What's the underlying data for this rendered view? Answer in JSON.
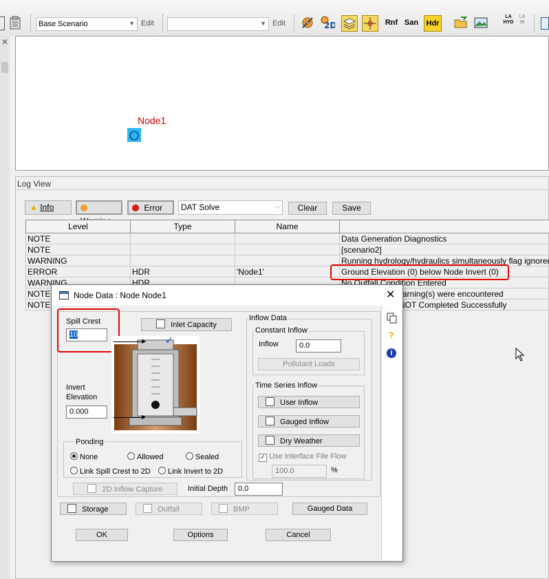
{
  "toolbar": {
    "scenario": "Base Scenario",
    "edit1": "Edit",
    "combo2": "",
    "edit2": "Edit",
    "icons": [
      "gear-run-icon",
      "2d-icon",
      "layers-icon",
      "crosshair-icon"
    ],
    "rnf": "Rnf",
    "san": "San",
    "hdr": "Hdr",
    "la_hyd_top": "LA",
    "la_hyd_bottom": "HYD",
    "la_ib_top": "LA",
    "la_ib_bottom": "IB"
  },
  "canvas": {
    "node_label": "Node1"
  },
  "log": {
    "title": "Log View",
    "filters": {
      "info": "Info",
      "warning": "Warning",
      "error": "Error"
    },
    "source": "DAT Solve",
    "clear": "Clear",
    "save": "Save",
    "columns": [
      "Level",
      "Type",
      "Name",
      ""
    ],
    "rows": [
      [
        "NOTE",
        "",
        "",
        "Data Generation Diagnostics"
      ],
      [
        "NOTE",
        "",
        "",
        "[scenario2]"
      ],
      [
        "WARNING",
        "",
        "",
        "Running hydrology/hydraulics simultaneously flag ignored"
      ],
      [
        "ERROR",
        "HDR",
        "'Node1'",
        "Ground Elevation (0) below Node Invert (0)"
      ],
      [
        "WARNING",
        "HDR",
        "",
        "No Outfall Condition Entered"
      ],
      [
        "NOTE",
        "",
        "",
        "Warning(s) were encountered"
      ],
      [
        "NOTE",
        "",
        "",
        "NOT Completed Successfully"
      ]
    ]
  },
  "dialog": {
    "title": "Node Data : Node Node1",
    "spill_crest_label": "Spill Crest",
    "spill_crest_value": "10",
    "inlet_capacity": "Inlet Capacity",
    "invert_label_1": "Invert",
    "invert_label_2": "Elevation",
    "invert_value": "0.000",
    "ponding": {
      "label": "Ponding",
      "none": "None",
      "allowed": "Allowed",
      "sealed": "Sealed",
      "link_spill": "Link Spill Crest to 2D",
      "link_invert": "Link Invert to 2D"
    },
    "inflow_capture": "2D Inflow Capture",
    "initial_depth_label": "Initial Depth",
    "initial_depth_value": "0.0",
    "inflow_data": "Inflow Data",
    "constant_inflow": "Constant Inflow",
    "inflow_label": "Inflow",
    "inflow_value": "0.0",
    "pollutant_loads": "Pollutant Loads",
    "time_series_inflow": "Time Series Inflow",
    "user_inflow": "User Inflow",
    "gauged_inflow": "Gauged Inflow",
    "dry_weather": "Dry Weather",
    "use_interface": "Use Interface File Flow",
    "interface_value": "100.0",
    "percent": "%",
    "storage": "Storage",
    "outfall": "Outfall",
    "bmp": "BMP",
    "gauged_data": "Gauged Data",
    "ok": "OK",
    "options": "Options",
    "cancel": "Cancel"
  },
  "colors": {
    "highlight": "#e60000",
    "node_fill": "#29b6f6",
    "node_label": "#cc0000"
  }
}
